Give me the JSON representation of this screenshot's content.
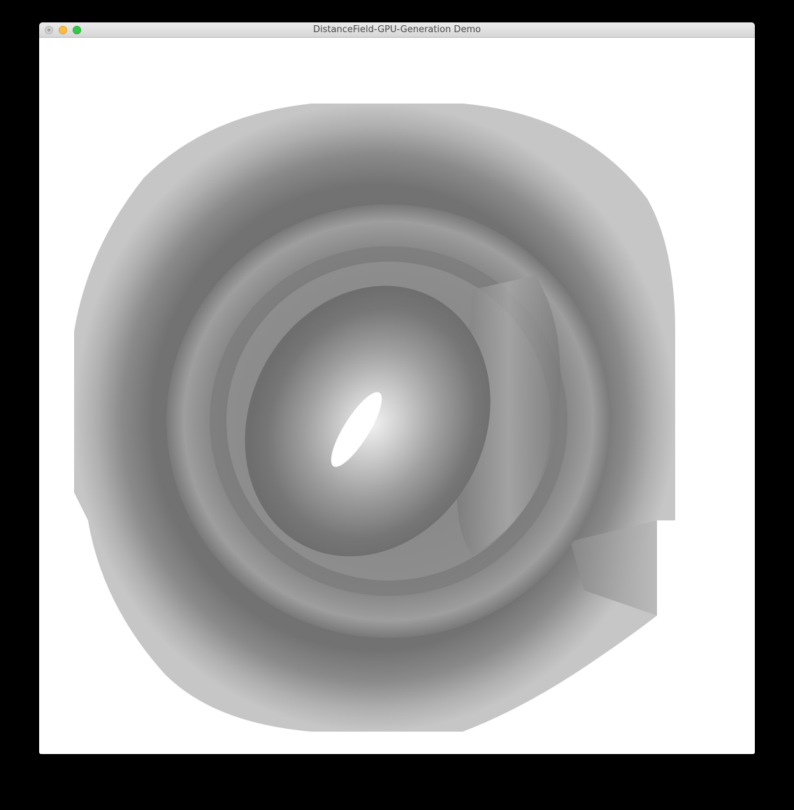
{
  "window": {
    "title": "DistanceField-GPU-Generation Demo"
  },
  "canvas": {
    "glyph": "@",
    "background_color": "#ffffff",
    "field_colors": {
      "edge": "#c4c4c4",
      "dark": "#6a6a6a",
      "mid": "#a8a8a8",
      "light": "#cfcfcf"
    }
  }
}
